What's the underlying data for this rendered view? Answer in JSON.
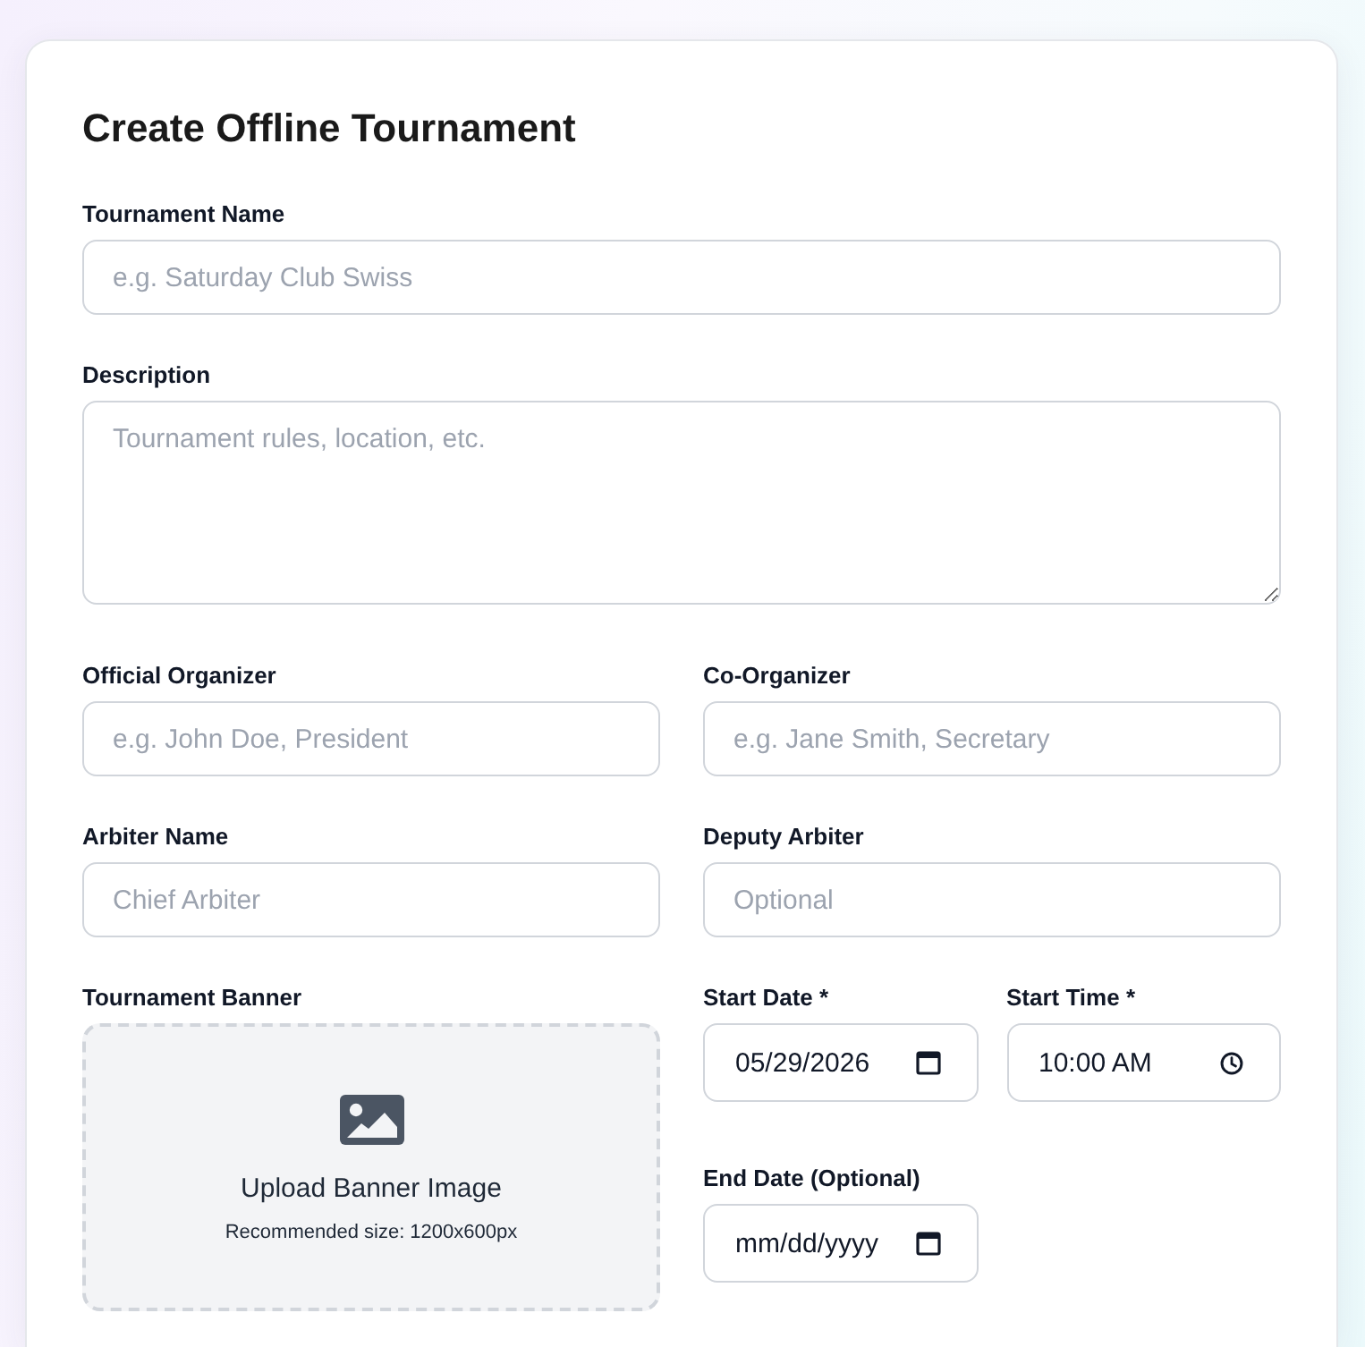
{
  "title": "Create Offline Tournament",
  "name_field": {
    "label": "Tournament Name",
    "placeholder": "e.g. Saturday Club Swiss"
  },
  "description_field": {
    "label": "Description",
    "placeholder": "Tournament rules, location, etc."
  },
  "people_fields": [
    {
      "label": "Official Organizer",
      "placeholder": "e.g. John Doe, President"
    },
    {
      "label": "Co-Organizer",
      "placeholder": "e.g. Jane Smith, Secretary"
    },
    {
      "label": "Arbiter Name",
      "placeholder": "Chief Arbiter"
    },
    {
      "label": "Deputy Arbiter",
      "placeholder": "Optional"
    }
  ],
  "banner": {
    "label": "Tournament Banner",
    "title": "Upload Banner Image",
    "hint": "Recommended size: 1200x600px"
  },
  "schedule": [
    {
      "kind": "date",
      "label": "Start Date *",
      "value": "05/29/2026"
    },
    {
      "kind": "time",
      "label": "Start Time *",
      "value": "10:00 AM"
    },
    {
      "kind": "date",
      "label": "End Date (Optional)",
      "placeholder": "mm/dd/yyyy"
    }
  ]
}
